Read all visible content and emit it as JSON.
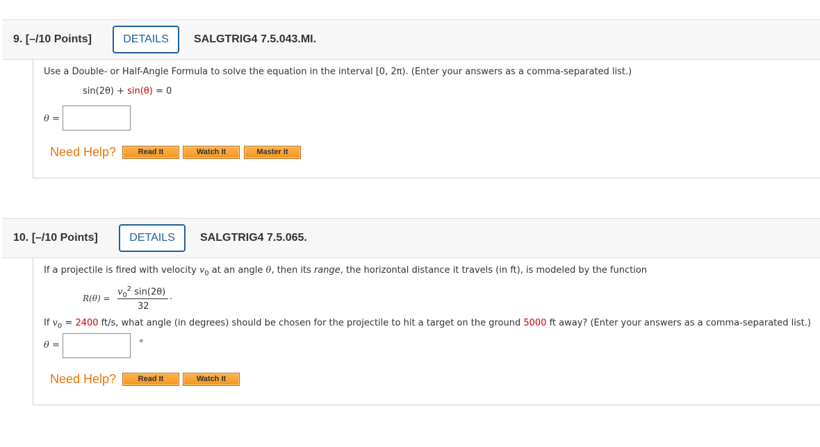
{
  "questions": [
    {
      "number": "9.",
      "points": "[–/10 Points]",
      "details_label": "DETAILS",
      "code": "SALGTRIG4 7.5.043.MI.",
      "prompt": "Use a Double- or Half-Angle Formula to solve the equation in the interval [0, 2π). (Enter your answers as a comma-separated list.)",
      "equation": {
        "lhs": "sin(2θ) + ",
        "red_part": "sin(θ)",
        "rhs": " = 0"
      },
      "answer_label": "θ =",
      "answer_value": "",
      "need_help": "Need Help?",
      "help_buttons": [
        "Read It",
        "Watch It",
        "Master It"
      ]
    },
    {
      "number": "10.",
      "points": "[–/10 Points]",
      "details_label": "DETAILS",
      "code": "SALGTRIG4 7.5.065.",
      "prompt_part1": "If a projectile is fired with velocity ",
      "prompt_v0": "v",
      "prompt_v0_sub": "0",
      "prompt_part2": " at an angle ",
      "prompt_theta": "θ",
      "prompt_part3": ", then its ",
      "prompt_range": "range",
      "prompt_part4": ", the horizontal distance it travels (in ft), is modeled by the function",
      "formula": {
        "lhs": "R(θ) =",
        "numerator_v": "v",
        "numerator_sub": "0",
        "numerator_sup": "2",
        "numerator_rest": " sin(2θ)",
        "denominator": "32",
        "period": "."
      },
      "condition": {
        "part1": "If ",
        "v": "v",
        "sub": "0",
        "eq": " = ",
        "velocity": "2400",
        "part2": " ft/s,  what angle (in degrees) should be chosen for the projectile to hit a target on the ground ",
        "distance": "5000",
        "part3": " ft away? (Enter your answers as a comma-separated list.)"
      },
      "answer_label": "θ =",
      "answer_value": "",
      "answer_unit": "°",
      "need_help": "Need Help?",
      "help_buttons": [
        "Read It",
        "Watch It"
      ]
    }
  ],
  "colors": {
    "accent_blue": "#1f5fa0",
    "help_orange": "#e8780c",
    "highlight_red": "#cc0000"
  }
}
